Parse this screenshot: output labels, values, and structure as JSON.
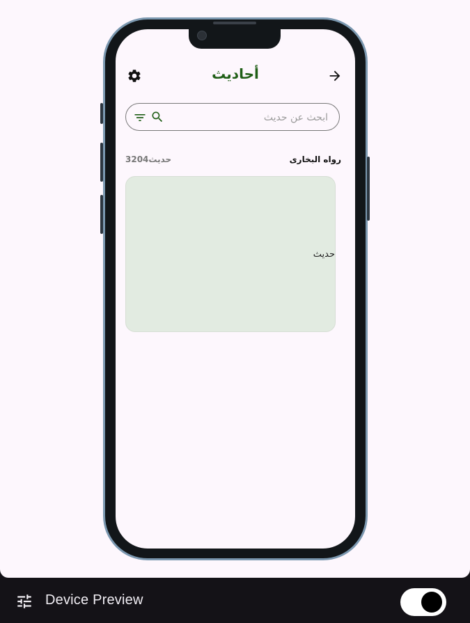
{
  "app": {
    "title": "أحاديث",
    "search_placeholder": "ابحث عن حديث",
    "book_name": "رواه البخارى",
    "book_count": "3204حديث",
    "hadith_text": "حديث"
  },
  "bottom_bar": {
    "label": "Device Preview",
    "toggle_on": true
  },
  "icons": {
    "settings": "gear-icon",
    "back": "arrow-right-icon",
    "filter": "filter-icon",
    "search": "search-icon",
    "tune": "tune-icon"
  },
  "colors": {
    "accent": "#1f5e16",
    "card": "#e2ebe1",
    "background": "#fdf7fd",
    "bar": "#141217"
  }
}
